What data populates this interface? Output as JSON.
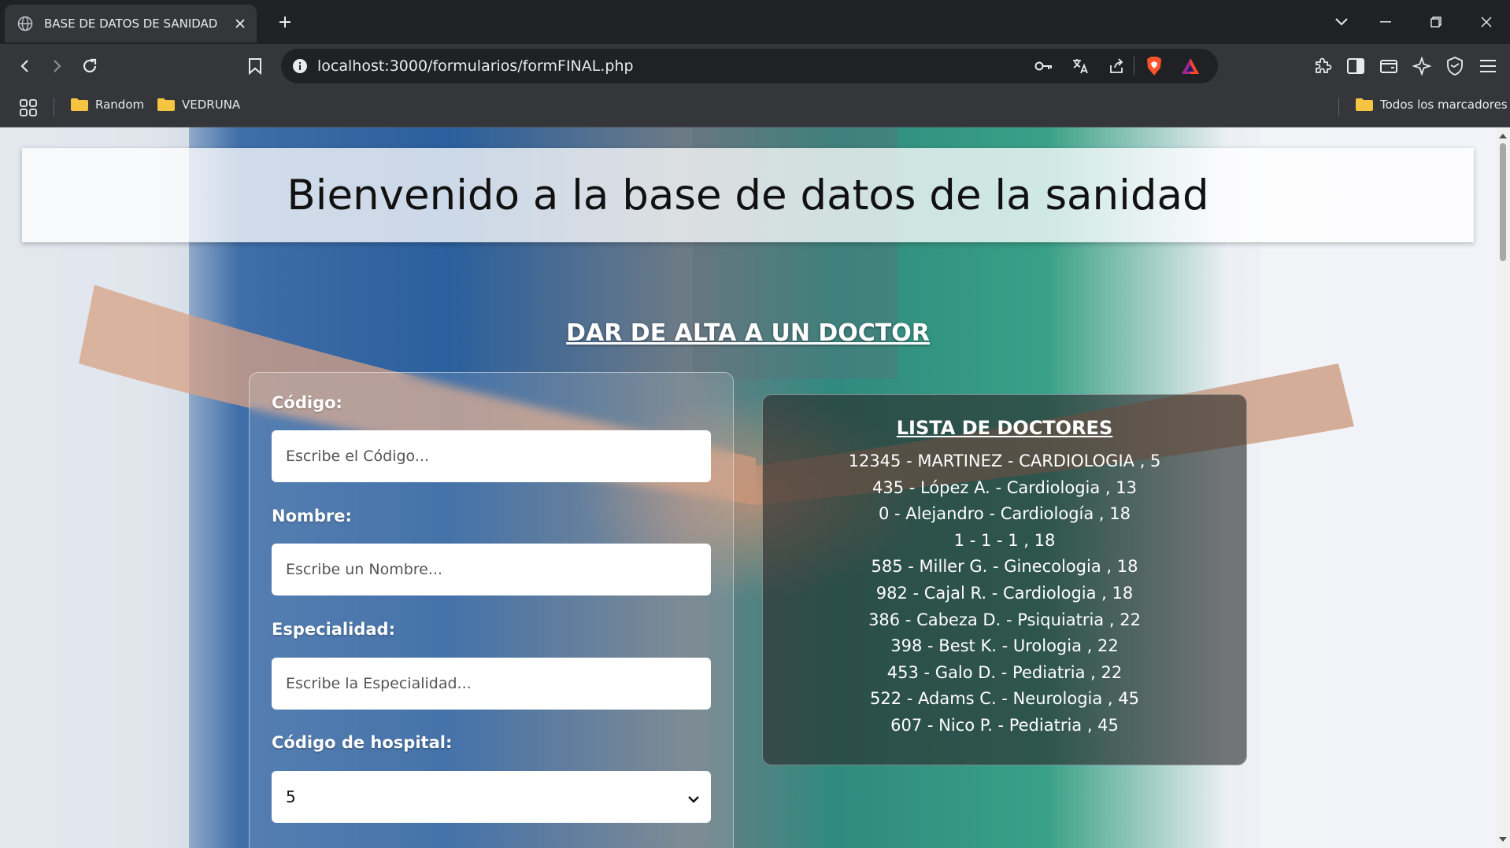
{
  "browser": {
    "tab_title": "BASE DE DATOS DE SANIDAD",
    "url": "localhost:3000/formularios/formFINAL.php",
    "bookmarks": [
      "Random",
      "VEDRUNA"
    ],
    "all_bookmarks": "Todos los marcadores",
    "icons": [
      "globe-icon",
      "close-icon",
      "plus-icon",
      "chevron-down-icon",
      "minimize-icon",
      "restore-icon",
      "back-icon",
      "forward-icon",
      "reload-icon",
      "bookmark-icon",
      "info-icon",
      "key-icon",
      "translate-icon",
      "share-icon",
      "brave-shield-icon",
      "brave-rewards-icon",
      "extensions-icon",
      "sidebar-icon",
      "wallet-icon",
      "leo-icon",
      "vpn-icon",
      "menu-icon",
      "apps-icon",
      "folder-icon"
    ]
  },
  "page": {
    "banner_title": "Bienvenido a la base de datos de la sanidad",
    "section_title": "DAR DE ALTA A UN DOCTOR",
    "form": {
      "codigo_label": "Código:",
      "codigo_placeholder": "Escribe el Código...",
      "nombre_label": "Nombre:",
      "nombre_placeholder": "Escribe un Nombre...",
      "especialidad_label": "Especialidad:",
      "especialidad_placeholder": "Escribe la Especialidad...",
      "hospital_label": "Código de hospital:",
      "hospital_selected": "5"
    },
    "list": {
      "title": "LISTA DE DOCTORES",
      "items": [
        "12345 - MARTINEZ - CARDIOLOGIA , 5",
        "435 - López A. - Cardiologia , 13",
        "0 - Alejandro - Cardiología , 18",
        "1 - 1 - 1 , 18",
        "585 - Miller G. - Ginecologia , 18",
        "982 - Cajal R. - Cardiologia , 18",
        "386 - Cabeza D. - Psiquiatria , 22",
        "398 - Best K. - Urologia , 22",
        "453 - Galo D. - Pediatria , 22",
        "522 - Adams C. - Neurologia , 45",
        "607 - Nico P. - Pediatria , 45"
      ]
    }
  },
  "colors": {
    "chrome_dark": "#202124",
    "chrome_toolbar": "#35363a",
    "brave_orange": "#fb542b",
    "folder_yellow": "#f5c542"
  }
}
